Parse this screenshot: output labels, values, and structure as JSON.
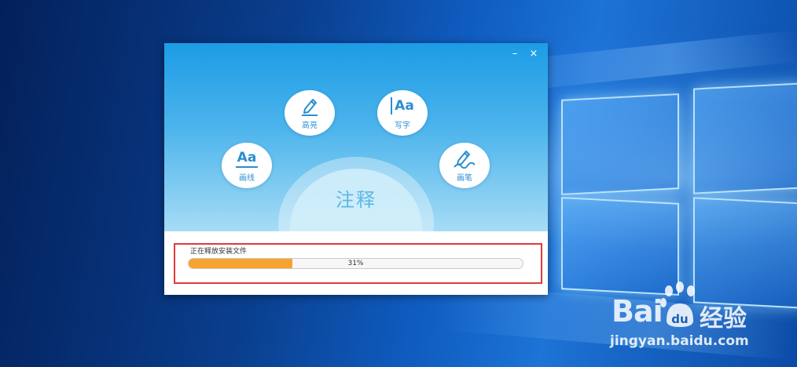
{
  "installer": {
    "title": "注释",
    "window_buttons": {
      "minimize": "–",
      "close": "×"
    },
    "features": [
      {
        "label": "高亮",
        "icon": "pen-underline-icon"
      },
      {
        "label": "写字",
        "icon": "text-cursor-aa-icon",
        "glyph": "Aa"
      },
      {
        "label": "画线",
        "icon": "text-aa-underline-icon",
        "glyph": "Aa"
      },
      {
        "label": "画笔",
        "icon": "pen-scribble-icon"
      }
    ],
    "status": "正在释放安装文件",
    "progress": {
      "percent": 31,
      "label": "31%"
    }
  },
  "colors": {
    "banner_top": "#1c9ce6",
    "progress_fill": "#f7a32f",
    "highlight_border": "#e03a3a"
  },
  "watermark": {
    "logo": "Bai",
    "logo_suffix": "du",
    "brand": "经验",
    "url": "jingyan.baidu.com"
  }
}
